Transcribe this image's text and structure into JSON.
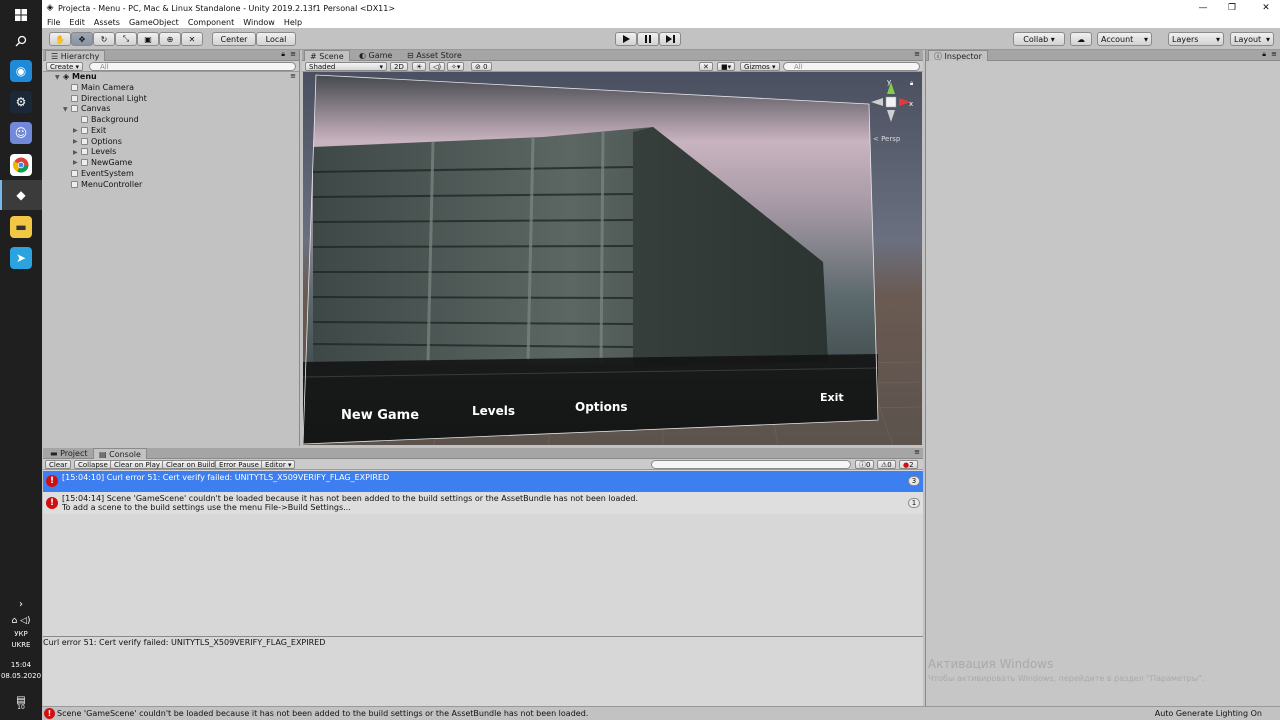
{
  "taskbar": {
    "icons": [
      "windows-icon",
      "search-icon",
      "eye-app-icon",
      "steam-icon",
      "discord-icon",
      "chrome-icon",
      "unity-icon",
      "file-explorer-icon",
      "telegram-icon"
    ],
    "lang_1": "УКР",
    "lang_2": "UKRE",
    "time": "15:04",
    "date": "08.05.2020",
    "notif_count": "10"
  },
  "window": {
    "title": "Projecta - Menu - PC, Mac & Linux Standalone - Unity 2019.2.13f1 Personal <DX11>"
  },
  "menu": [
    "File",
    "Edit",
    "Assets",
    "GameObject",
    "Component",
    "Window",
    "Help"
  ],
  "toolbar": {
    "center": "Center",
    "local": "Local",
    "collab": "Collab ▾",
    "account": "Account",
    "layers": "Layers",
    "layout": "Layout"
  },
  "hierarchy": {
    "tab": "Hierarchy",
    "create": "Create ▾",
    "search_placeholder": "All",
    "scene": "Menu",
    "items": [
      "Main Camera",
      "Directional Light",
      "Canvas",
      "Background",
      "Exit",
      "Options",
      "Levels",
      "NewGame",
      "EventSystem",
      "MenuController"
    ]
  },
  "scene": {
    "tabs": [
      "Scene",
      "Game",
      "Asset Store"
    ],
    "shading": "Shaded",
    "mode_2d": "2D",
    "fx_count": "0",
    "gizmos": "Gizmos",
    "search_placeholder": "All",
    "persp": "< Persp",
    "axis_y": "y",
    "axis_x": "x",
    "buttons": {
      "new_game": "New Game",
      "levels": "Levels",
      "options": "Options",
      "exit": "Exit"
    }
  },
  "console": {
    "tabs": [
      "Project",
      "Console"
    ],
    "buttons": [
      "Clear",
      "Collapse",
      "Clear on Play",
      "Clear on Build",
      "Error Pause",
      "Editor ▾"
    ],
    "info_count": "0",
    "warn_count": "0",
    "error_count": "2",
    "rows": [
      {
        "line1": "[15:04:10] Curl error 51: Cert verify failed: UNITYTLS_X509VERIFY_FLAG_EXPIRED",
        "line2": "",
        "count": "3"
      },
      {
        "line1": "[15:04:14] Scene 'GameScene' couldn't be loaded because it has not been added to the build settings or the AssetBundle has not been loaded.",
        "line2": "To add a scene to the build settings use the menu File->Build Settings...",
        "count": "1"
      }
    ],
    "detail": "Curl error 51: Cert verify failed: UNITYTLS_X509VERIFY_FLAG_EXPIRED"
  },
  "inspector": {
    "tab": "Inspector"
  },
  "watermark": {
    "line1": "Активация Windows",
    "line2": "Чтобы активировать Windows, перейдите в раздел \"Параметры\"."
  },
  "status": {
    "message": "Scene 'GameScene' couldn't be loaded because it has not been added to the build settings or the AssetBundle has not been loaded.",
    "right": "Auto Generate Lighting On"
  },
  "colors": {
    "selection": "#3d7ef0",
    "error": "#d01010",
    "editor_bg": "#c2c2c2",
    "taskbar": "#1f1f1f"
  }
}
